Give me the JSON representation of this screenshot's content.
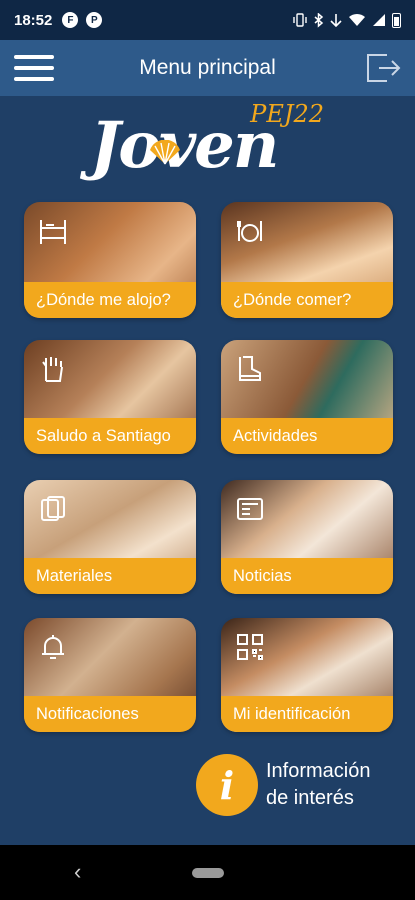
{
  "status_bar": {
    "time": "18:52",
    "app_icons": [
      "F",
      "P"
    ]
  },
  "header": {
    "title": "Menu principal",
    "background": "#2e5a8a"
  },
  "logo": {
    "main_text": "Joven",
    "tag_text": "PEJ22"
  },
  "tiles": [
    {
      "label": "¿Dónde me alojo?",
      "icon": "bunk-bed-icon"
    },
    {
      "label": "¿Dónde comer?",
      "icon": "dining-icon"
    },
    {
      "label": "Saludo a Santiago",
      "icon": "hand-icon"
    },
    {
      "label": "Actividades",
      "icon": "hiking-boot-icon"
    },
    {
      "label": "Materiales",
      "icon": "documents-icon"
    },
    {
      "label": "Noticias",
      "icon": "newspaper-icon"
    },
    {
      "label": "Notificaciones",
      "icon": "bell-icon"
    },
    {
      "label": "Mi identificación",
      "icon": "qr-code-icon"
    }
  ],
  "info": {
    "glyph": "i",
    "line1": "Información",
    "line2": "de interés"
  },
  "colors": {
    "accent": "#f2a81d",
    "background": "#1f3f66",
    "status_bar": "#0f2745"
  }
}
